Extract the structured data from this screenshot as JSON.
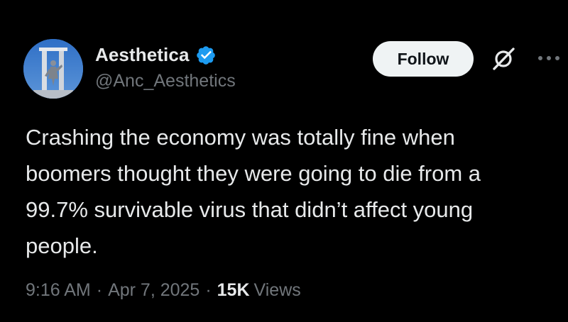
{
  "author": {
    "display_name": "Aesthetica",
    "handle": "@Anc_Aesthetics",
    "verified": true,
    "avatar_icon": "classical-statue-avatar",
    "verified_color": "#1d9bf0"
  },
  "actions": {
    "follow_label": "Follow",
    "grok_icon": "grok-icon",
    "more_icon": "more-options-icon"
  },
  "tweet": {
    "text": "Crashing the economy was totally fine when\nboomers thought they were going to die from a\n99.7% survivable virus that didn’t affect young\npeople."
  },
  "meta": {
    "time": "9:16 AM",
    "separator": "·",
    "date": "Apr 7, 2025",
    "views_count": "15K",
    "views_label": "Views"
  },
  "colors": {
    "background": "#000000",
    "primary_text": "#e7e9ea",
    "secondary_text": "#71767b",
    "follow_bg": "#eff3f4"
  }
}
